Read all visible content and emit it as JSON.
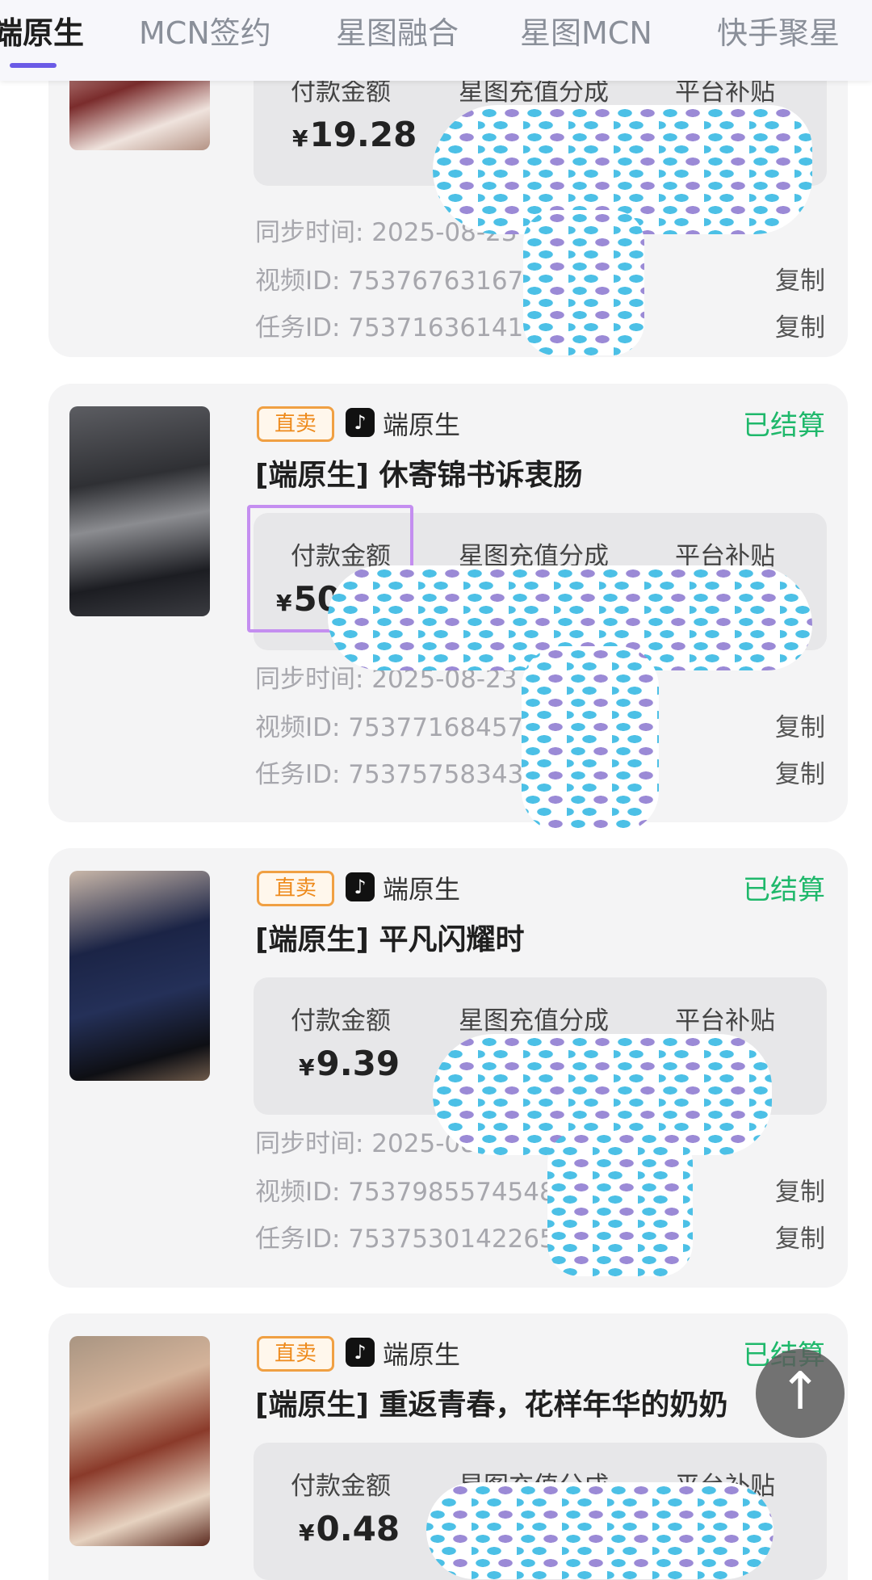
{
  "tabs": [
    {
      "label": "端原生"
    },
    {
      "label": "MCN签约"
    },
    {
      "label": "星图融合"
    },
    {
      "label": "星图MCN"
    },
    {
      "label": "快手聚星"
    }
  ],
  "labels": {
    "pay_amount": "付款金额",
    "recharge_share": "星图充值分成",
    "platform_subsidy": "平台补贴",
    "copy": "复制"
  },
  "orders": [
    {
      "pay": "19.28",
      "sync_time": "同步时间: 2025-08-23 02",
      "video_id": "视频ID: 7537676316766",
      "task_id": "任务ID: 7537163614118"
    },
    {
      "tag": "直卖",
      "channel": "端原生",
      "status": "已结算",
      "title": "[端原生] 休寄锦书诉衷肠",
      "pay": "508.39",
      "sync_time": "同步时间: 2025-08-23 02",
      "video_id": "视频ID: 7537716845751",
      "task_id": "任务ID: 7537575834398"
    },
    {
      "tag": "直卖",
      "channel": "端原生",
      "status": "已结算",
      "title": "[端原生] 平凡闪耀时",
      "pay": "9.39",
      "sync_time": "同步时间: 2025-08-23 02",
      "video_id": "视频ID: 7537985574548",
      "task_id": "任务ID: 7537530142265"
    },
    {
      "tag": "直卖",
      "channel": "端原生",
      "status": "已结算",
      "title": "[端原生] 重返青春，花样年华的奶奶",
      "pay": "0.48"
    }
  ],
  "currency": "¥",
  "tiktok_icon": "♪",
  "scroll_top_icon": "↑"
}
